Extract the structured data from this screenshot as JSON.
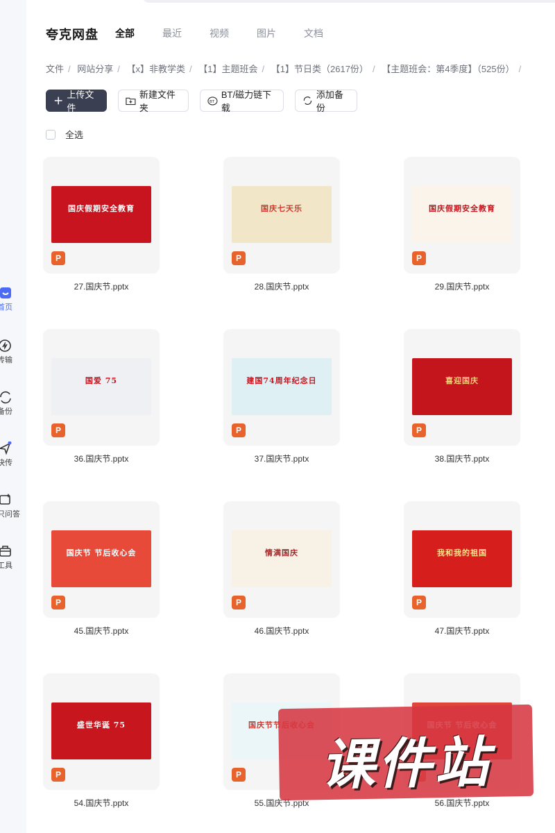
{
  "app": {
    "brand": "夸克网盘"
  },
  "tabs": [
    {
      "label": "全部",
      "active": true
    },
    {
      "label": "最近",
      "active": false
    },
    {
      "label": "视频",
      "active": false
    },
    {
      "label": "图片",
      "active": false
    },
    {
      "label": "文档",
      "active": false
    }
  ],
  "sidebar": {
    "items": [
      {
        "label": "首页",
        "icon": "home-icon"
      },
      {
        "label": "传输",
        "icon": "transfer-icon"
      },
      {
        "label": "备份",
        "icon": "backup-icon"
      },
      {
        "label": "快传",
        "icon": "quick-send-icon"
      },
      {
        "label": "只问答",
        "icon": "qa-icon"
      },
      {
        "label": "工具",
        "icon": "tools-icon"
      }
    ]
  },
  "breadcrumb": [
    "文件",
    "网站分享",
    "【x】非教学类",
    "【1】主题班会",
    "【1】节日类（2617份）",
    "【主题班会：第4季度】（525份）"
  ],
  "breadcrumb_sep": "/",
  "toolbar": {
    "upload": "上传文件",
    "new_folder": "新建文件夹",
    "bt": "BT/磁力链下载",
    "backup": "添加备份"
  },
  "select_all": "全选",
  "files": [
    {
      "name": "27.国庆节.pptx",
      "thumb_title": "国庆假期安全教育",
      "bg": "#c8141e",
      "fg": "#ffffff"
    },
    {
      "name": "28.国庆节.pptx",
      "thumb_title": "国庆七天乐",
      "bg": "#f2e6c8",
      "fg": "#d8352c"
    },
    {
      "name": "29.国庆节.pptx",
      "thumb_title": "国庆假期安全教育",
      "bg": "#fbf4ea",
      "fg": "#c8141e"
    },
    {
      "name": "36.国庆节.pptx",
      "thumb_title": "国爱 75",
      "bg": "#eef0f4",
      "fg": "#c8141e"
    },
    {
      "name": "37.国庆节.pptx",
      "thumb_title": "建国74周年纪念日",
      "bg": "#dff0f4",
      "fg": "#c8141e"
    },
    {
      "name": "38.国庆节.pptx",
      "thumb_title": "喜迎国庆",
      "bg": "#c4141c",
      "fg": "#f7d27a"
    },
    {
      "name": "45.国庆节.pptx",
      "thumb_title": "国庆节 节后收心会",
      "bg": "#e84a3a",
      "fg": "#ffffff"
    },
    {
      "name": "46.国庆节.pptx",
      "thumb_title": "情满国庆",
      "bg": "#f7f1e6",
      "fg": "#a8282a"
    },
    {
      "name": "47.国庆节.pptx",
      "thumb_title": "我和我的祖国",
      "bg": "#d61f1c",
      "fg": "#ffe58a"
    },
    {
      "name": "54.国庆节.pptx",
      "thumb_title": "盛世华诞 75",
      "bg": "#c8161e",
      "fg": "#ffffff"
    },
    {
      "name": "55.国庆节.pptx",
      "thumb_title": "国庆节节后收心会",
      "bg": "#eaf6f8",
      "fg": "#d8352c"
    },
    {
      "name": "56.国庆节.pptx",
      "thumb_title": "国庆节 节后收心会",
      "bg": "#e0453a",
      "fg": "#ffffff"
    }
  ],
  "file_badge": "P",
  "watermark": "课件站"
}
